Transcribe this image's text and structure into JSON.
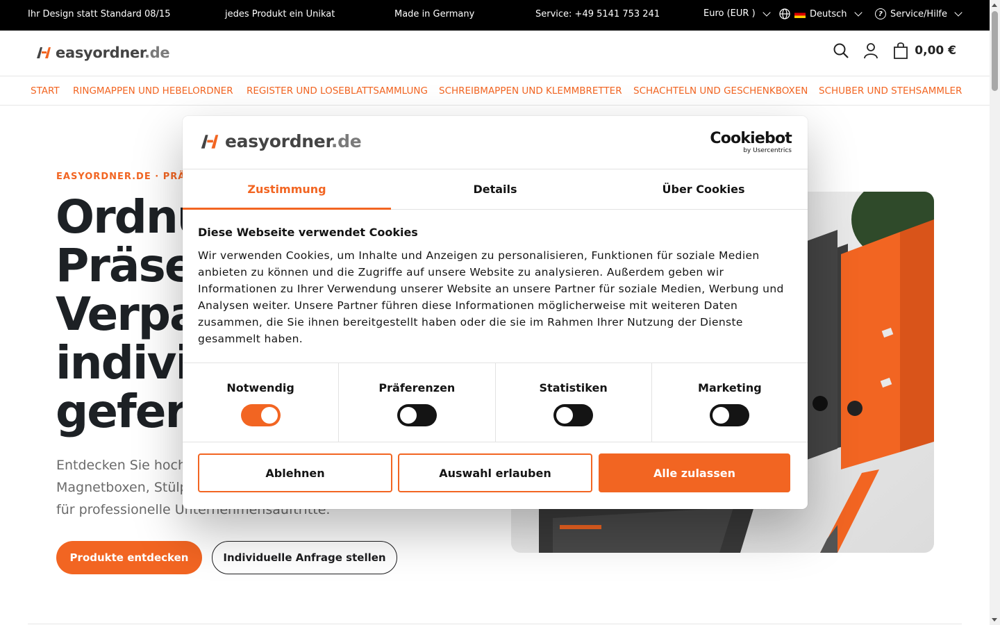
{
  "topbar": {
    "items": [
      "Ihr Design statt Standard 08/15",
      "jedes Produkt ein Unikat",
      "Made in Germany",
      "Service: +49 5141 753 241"
    ],
    "currency": "Euro (EUR )",
    "language": "Deutsch",
    "service": "Service/Hilfe"
  },
  "header": {
    "logo_main": "easyordner",
    "logo_tld": ".de",
    "cart_total": "0,00 €"
  },
  "nav": [
    "START",
    "RINGMAPPEN UND HEBELORDNER",
    "REGISTER UND LOSEBLATTSAMMLUNG",
    "SCHREIBMAPPEN UND KLEMMBRETTER",
    "SCHACHTELN UND GESCHENKBOXEN",
    "SCHUBER UND STEHSAMMLER"
  ],
  "hero": {
    "eyebrow": "EASYORDNER.DE · PRÄSE",
    "title_lines": [
      "Ordnu",
      "Präsen",
      "Verpac",
      "individ",
      "gefert"
    ],
    "subtitle_lines": [
      "Entdecken Sie hocht",
      "Magnetboxen, Stülp",
      "für professionelle Unternehmensauftritte."
    ],
    "primary_button": "Produkte entdecken",
    "secondary_button": "Individuelle Anfrage stellen"
  },
  "cookie": {
    "logo_main": "easyordner",
    "logo_tld": ".de",
    "provider_name": "Cookiebot",
    "provider_sub": "by Usercentrics",
    "tabs": [
      "Zustimmung",
      "Details",
      "Über Cookies"
    ],
    "active_tab": "Zustimmung",
    "heading": "Diese Webseite verwendet Cookies",
    "body": "Wir verwenden Cookies, um Inhalte und Anzeigen zu personalisieren, Funktionen für soziale Medien anbieten zu können und die Zugriffe auf unsere Website zu analysieren. Außerdem geben wir Informationen zu Ihrer Verwendung unserer Website an unsere Partner für soziale Medien, Werbung und Analysen weiter. Unsere Partner führen diese Informationen möglicherweise mit weiteren Daten zusammen, die Sie ihnen bereitgestellt haben oder die sie im Rahmen Ihrer Nutzung der Dienste gesammelt haben.",
    "categories": [
      {
        "label": "Notwendig",
        "enabled": true
      },
      {
        "label": "Präferenzen",
        "enabled": false
      },
      {
        "label": "Statistiken",
        "enabled": false
      },
      {
        "label": "Marketing",
        "enabled": false
      }
    ],
    "buttons": {
      "decline": "Ablehnen",
      "allow_selection": "Auswahl erlauben",
      "allow_all": "Alle zulassen"
    }
  },
  "colors": {
    "accent": "#f26522",
    "dark": "#141414"
  }
}
